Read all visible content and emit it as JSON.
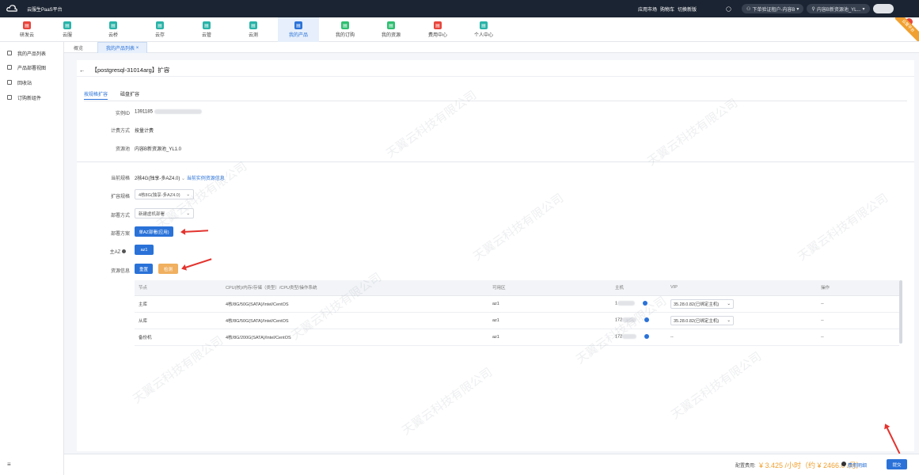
{
  "topbar": {
    "brand": "云服生PaaS平台",
    "links": [
      "应用市场",
      "购物车",
      "切换新版"
    ],
    "account": "下单验证租户-内容B",
    "resource_pool": "内容B新资源池_YL..."
  },
  "nav": {
    "items": [
      {
        "label": "研发云",
        "color": "#e8453c"
      },
      {
        "label": "云服",
        "color": "#29b3a8"
      },
      {
        "label": "云桥",
        "color": "#29b3a8"
      },
      {
        "label": "云存",
        "color": "#29b3a8"
      },
      {
        "label": "云管",
        "color": "#29b3a8"
      },
      {
        "label": "云测",
        "color": "#29b3a8"
      },
      {
        "label": "我的产品",
        "color": "#2a72d8"
      },
      {
        "label": "我的订购",
        "color": "#2fbf71"
      },
      {
        "label": "我的资源",
        "color": "#2fbf71"
      },
      {
        "label": "费用中心",
        "color": "#e8453c"
      },
      {
        "label": "个人中心",
        "color": "#29b3a8"
      }
    ],
    "corner_badge": "云管平台"
  },
  "sidebar": {
    "items": [
      "我的产品列表",
      "产品部署视图",
      "回收站",
      "订购新组件"
    ],
    "collapse_icon": "≡"
  },
  "tabs": [
    "概览",
    "我的产品列表"
  ],
  "tab_close": "×",
  "page": {
    "back_icon": "←",
    "title": "【postgresql-31014arg】扩容",
    "subtabs": [
      "按规格扩容",
      "磁盘扩容"
    ]
  },
  "info": {
    "instance_label": "实例ID",
    "instance_value": "1391185",
    "billing_label": "计费方式",
    "billing_value": "按量计费",
    "pool_label": "资源池",
    "pool_value": "内容B新资源池_YL1.0"
  },
  "form": {
    "current_spec_label": "当前规格",
    "current_spec_value": "2核4G(独享-多AZ4.0)",
    "current_spec_link": "当前实例资源信息",
    "expand_spec_label": "扩容规格",
    "expand_spec_value": "4核8G(独享-多AZ4.0)",
    "deploy_mode_label": "部署方式",
    "deploy_mode_value": "新建虚机部署",
    "deploy_plan_label": "部署方案",
    "deploy_plan_button": "单AZ部署(应用)",
    "main_az_label": "主AZ",
    "main_az_button": "az1",
    "resource_label": "资源信息",
    "resource_btn_primary": "重置",
    "resource_btn_secondary": "检测"
  },
  "table": {
    "headers": [
      "节点",
      "CPU(核)/内存/存储（类型）/CPU类型/操作系统",
      "可用区",
      "主机",
      "VIP",
      "操作"
    ],
    "rows": [
      {
        "node": "主库",
        "spec": "4核/8G/50G(SATA)/Intel/CentOS",
        "az": "az1",
        "host": "1",
        "vip": "35.28.0.82(已绑定主机)",
        "op": "--"
      },
      {
        "node": "从库",
        "spec": "4核/8G/50G(SATA)/Intel/CentOS",
        "az": "az1",
        "host": "172",
        "vip": "35.28.0.82(已绑定主机)",
        "op": "--"
      },
      {
        "node": "备份机",
        "spec": "4核/8G/200G(SATA)/Intel/CentOS",
        "az": "az1",
        "host": "172",
        "vip": "--",
        "op": "--"
      }
    ]
  },
  "watermark": "天翼云科技有限公司",
  "footer": {
    "fee_label": "配置费用:",
    "fee_value": "¥ 3.425 /小时（约 ¥ 2466.0 /月）",
    "fee_link": "费用明细",
    "submit": "提交"
  }
}
